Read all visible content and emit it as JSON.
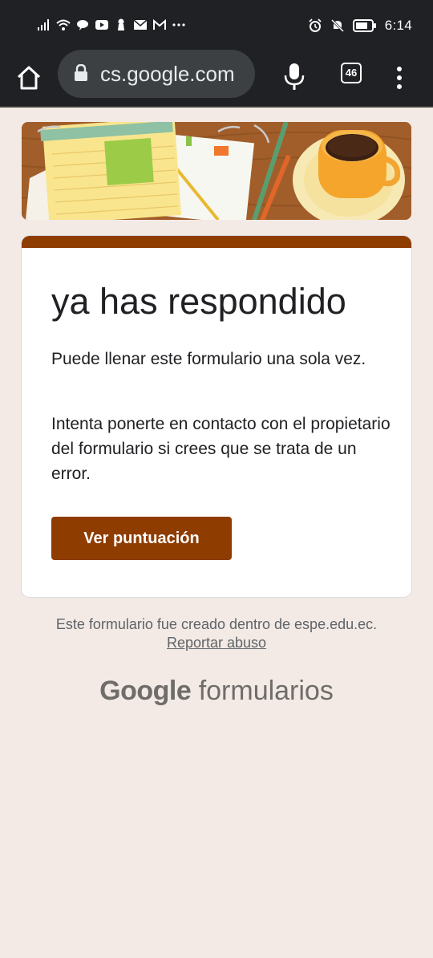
{
  "status_bar": {
    "time": "6:14",
    "left_icons": [
      "signal-icon",
      "wifi-icon",
      "chat-icon",
      "youtube-icon",
      "keyhole-icon",
      "mail-icon",
      "gmail-icon",
      "more-dots-icon"
    ],
    "right_icons": [
      "alarm-icon",
      "mute-icon",
      "battery-icon"
    ]
  },
  "browser": {
    "url": "cs.google.com",
    "tab_count": "46"
  },
  "card": {
    "title": "ya has respondido",
    "paragraph_1": "Puede llenar este formulario una sola vez.",
    "paragraph_2": "Intenta ponerte en contacto con el propietario del formulario si crees que se trata de un error.",
    "button_label": "Ver puntuación"
  },
  "footer": {
    "note": "Este formulario fue creado dentro de espe.edu.ec.",
    "report_link": "Reportar abuso",
    "brand_google": "Google",
    "brand_product": "formularios"
  },
  "colors": {
    "accent": "#8e3c00",
    "page_background": "#f3eae5",
    "chrome_bar": "#202124"
  }
}
